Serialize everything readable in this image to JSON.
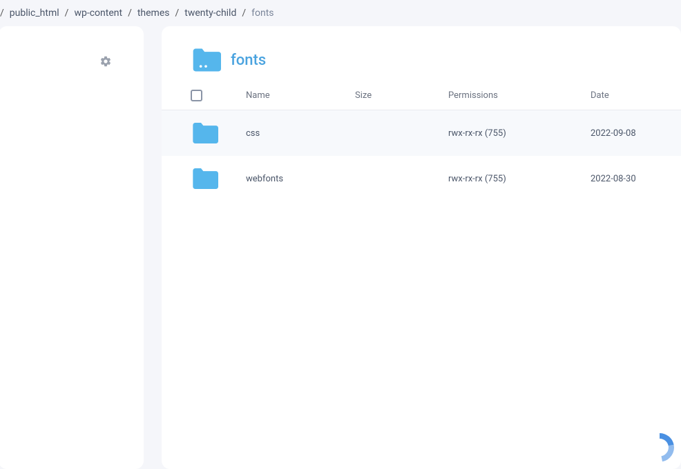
{
  "breadcrumb": {
    "items": [
      "public_html",
      "wp-content",
      "themes",
      "twenty-child"
    ],
    "current": "fonts"
  },
  "folder": {
    "title": "fonts"
  },
  "columns": {
    "name": "Name",
    "size": "Size",
    "permissions": "Permissions",
    "date": "Date"
  },
  "rows": [
    {
      "name": "css",
      "size": "",
      "permissions": "rwx-rx-rx (755)",
      "date": "2022-09-08"
    },
    {
      "name": "webfonts",
      "size": "",
      "permissions": "rwx-rx-rx (755)",
      "date": "2022-08-30"
    }
  ]
}
